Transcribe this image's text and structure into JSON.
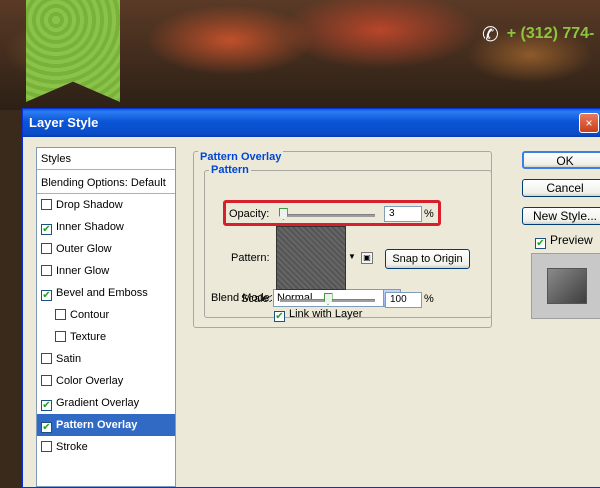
{
  "background": {
    "phone": "+ (312) 774-"
  },
  "dialog": {
    "title": "Layer Style",
    "close_glyph": "×"
  },
  "style_list": {
    "header": "Styles",
    "blending": "Blending Options: Default",
    "items": [
      {
        "label": "Drop Shadow",
        "checked": false
      },
      {
        "label": "Inner Shadow",
        "checked": true
      },
      {
        "label": "Outer Glow",
        "checked": false
      },
      {
        "label": "Inner Glow",
        "checked": false
      },
      {
        "label": "Bevel and Emboss",
        "checked": true
      },
      {
        "label": "Contour",
        "checked": false
      },
      {
        "label": "Texture",
        "checked": false
      },
      {
        "label": "Satin",
        "checked": false
      },
      {
        "label": "Color Overlay",
        "checked": false
      },
      {
        "label": "Gradient Overlay",
        "checked": true
      },
      {
        "label": "Pattern Overlay",
        "checked": true
      },
      {
        "label": "Stroke",
        "checked": false
      }
    ]
  },
  "panel": {
    "group_title": "Pattern Overlay",
    "inner_title": "Pattern",
    "blend_mode_label": "Blend Mode:",
    "blend_mode_value": "Normal",
    "opacity_label": "Opacity:",
    "opacity_value": "3",
    "opacity_unit": "%",
    "pattern_label": "Pattern:",
    "snap_button": "Snap to Origin",
    "scale_label": "Scale:",
    "scale_value": "100",
    "scale_unit": "%",
    "link_label": "Link with Layer",
    "link_checked": true
  },
  "buttons": {
    "ok": "OK",
    "cancel": "Cancel",
    "new_style": "New Style...",
    "preview_label": "Preview",
    "preview_checked": true
  },
  "colors": {
    "selection": "#316ac5",
    "highlight": "#d7202c",
    "titlebar": "#0a55d6"
  }
}
